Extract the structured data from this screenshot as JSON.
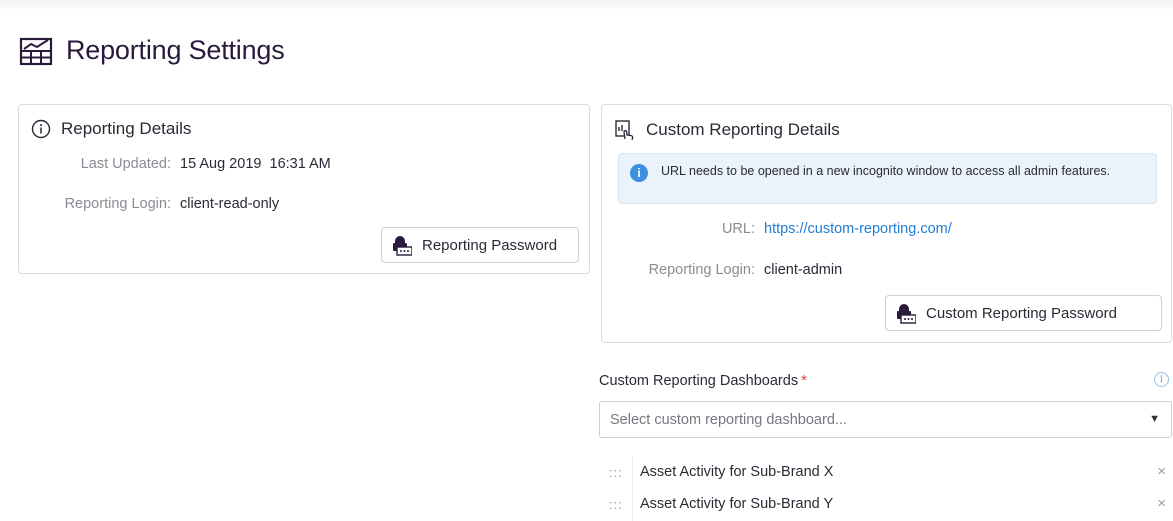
{
  "page": {
    "title": "Reporting Settings",
    "icon": "report-chart-icon"
  },
  "reporting_details": {
    "title": "Reporting Details",
    "icon": "info-circle-icon",
    "last_updated_label": "Last Updated:",
    "last_updated_value": "15 Aug 2019  16:31 AM",
    "login_label": "Reporting Login:",
    "login_value": "client-read-only",
    "password_button": "Reporting Password",
    "password_icon": "lock-password-icon"
  },
  "custom_reporting": {
    "title": "Custom Reporting Details",
    "icon": "touch-report-icon",
    "alert_text": "URL needs to be opened in a new incognito window to access all admin features.",
    "alert_icon_glyph": "i",
    "url_label": "URL:",
    "url_value": "https://custom-reporting.com/",
    "login_label": "Reporting Login:",
    "login_value": "client-admin",
    "password_button": "Custom Reporting Password",
    "password_icon": "lock-password-icon"
  },
  "dashboards": {
    "label": "Custom Reporting Dashboards",
    "required_mark": "*",
    "info_glyph": "i",
    "placeholder": "Select custom reporting dashboard...",
    "caret": "▼",
    "items": [
      {
        "label": "Asset Activity for Sub-Brand X",
        "handle": ":::",
        "remove": "×"
      },
      {
        "label": "Asset Activity for Sub-Brand Y",
        "handle": ":::",
        "remove": "×"
      }
    ]
  },
  "colors": {
    "accent": "#2a1b3d",
    "link": "#1f7ed6",
    "alert_bg": "#eaf3fb",
    "required": "#e0414a"
  }
}
